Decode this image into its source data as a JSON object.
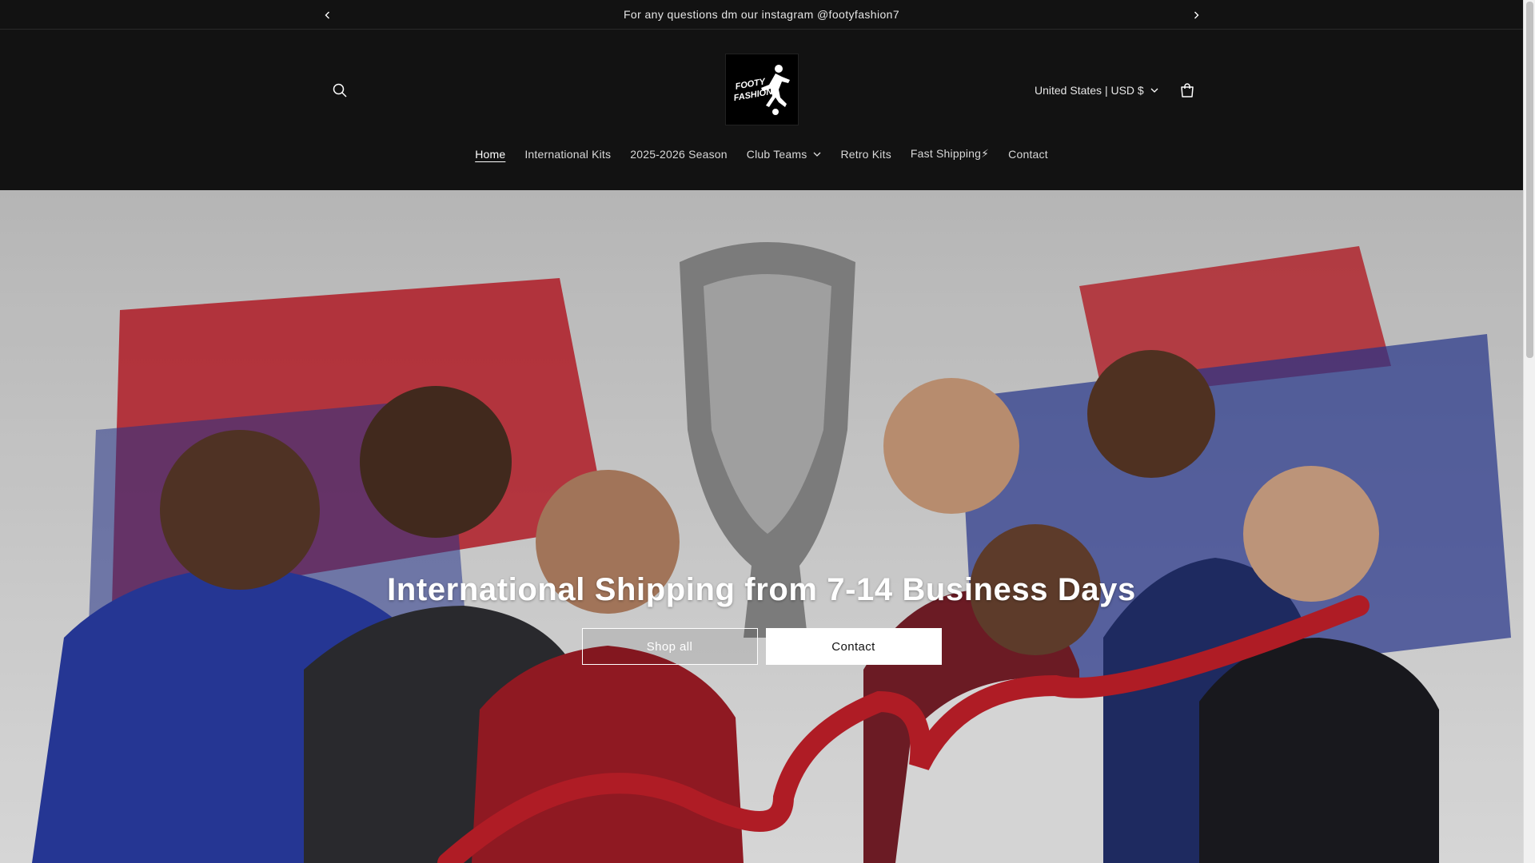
{
  "announcement": {
    "message": "For any questions dm our instagram @footyfashion7"
  },
  "header": {
    "logo_text_line1": "FOOTY",
    "logo_text_line2": "FASHION",
    "country_selector": "United States | USD $"
  },
  "nav": {
    "items": [
      {
        "label": "Home",
        "active": true
      },
      {
        "label": "International Kits"
      },
      {
        "label": "2025-2026 Season"
      },
      {
        "label": "Club Teams",
        "has_dropdown": true
      },
      {
        "label": "Retro Kits"
      },
      {
        "label": "Fast Shipping⚡"
      },
      {
        "label": "Contact"
      }
    ]
  },
  "hero": {
    "title": "International Shipping from 7-14 Business Days",
    "buttons": [
      {
        "label": "Shop all",
        "style": "outline"
      },
      {
        "label": "Contact",
        "style": "solid"
      }
    ]
  },
  "colors": {
    "background": "#121212",
    "text": "#ffffff",
    "accent_red": "#c8202b",
    "accent_blue": "#2a3a9c"
  }
}
